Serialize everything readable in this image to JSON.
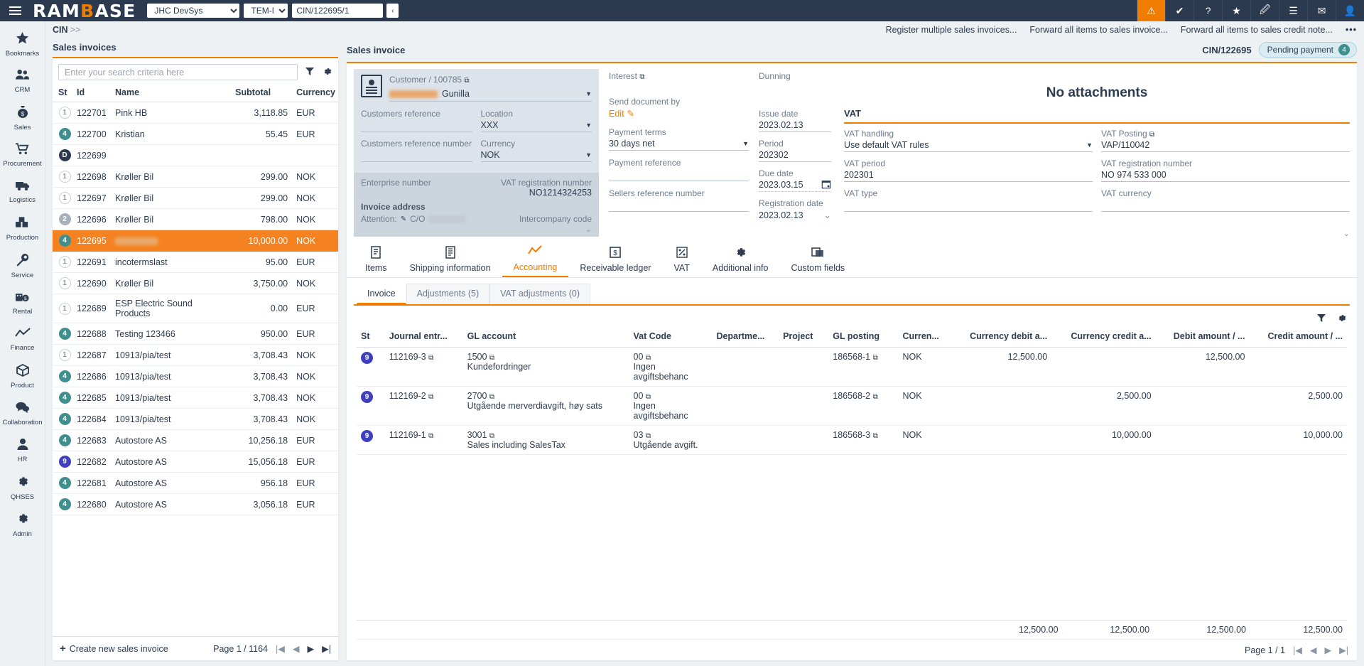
{
  "topbar": {
    "brand_left": "RAM",
    "brand_accent": "B",
    "brand_right": "ASE",
    "company": "JHC DevSys",
    "template": "TEM-NO",
    "document_ref": "CIN/122695/1",
    "collapse_icon": "‹",
    "icons": [
      {
        "name": "alert-icon",
        "glyph": "⚠",
        "active": true
      },
      {
        "name": "approval-icon",
        "glyph": "✔"
      },
      {
        "name": "help-icon",
        "glyph": "?"
      },
      {
        "name": "favorite-icon",
        "glyph": "★"
      },
      {
        "name": "attachment-icon",
        "glyph": "🖉"
      },
      {
        "name": "tasklist-icon",
        "glyph": "☰"
      },
      {
        "name": "mail-icon",
        "glyph": "✉"
      },
      {
        "name": "user-icon",
        "glyph": "👤"
      }
    ]
  },
  "sidebar": {
    "items": [
      {
        "label": "Bookmarks",
        "icon": "★"
      },
      {
        "label": "CRM",
        "icon": "👥"
      },
      {
        "label": "Sales",
        "icon": "💰"
      },
      {
        "label": "Procurement",
        "icon": "🛒"
      },
      {
        "label": "Logistics",
        "icon": "🚚"
      },
      {
        "label": "Production",
        "icon": "📦"
      },
      {
        "label": "Service",
        "icon": "🔧"
      },
      {
        "label": "Rental",
        "icon": "🏭"
      },
      {
        "label": "Finance",
        "icon": "📈"
      },
      {
        "label": "Product",
        "icon": "⬛"
      },
      {
        "label": "Collaboration",
        "icon": "💬"
      },
      {
        "label": "HR",
        "icon": "👤"
      },
      {
        "label": "QHSES",
        "icon": "⚙"
      },
      {
        "label": "Admin",
        "icon": "⚙"
      }
    ]
  },
  "breadcrumb": {
    "root": "CIN",
    "chevrons": ">>"
  },
  "actions": {
    "register_multiple": "Register multiple sales invoices...",
    "forward_invoice": "Forward all items to sales invoice...",
    "forward_credit": "Forward all items to sales credit note...",
    "more": "•••"
  },
  "list": {
    "title": "Sales invoices",
    "search_placeholder": "Enter your search criteria here",
    "filter_icon": "filter-icon",
    "settings_icon": "gear-icon",
    "columns": [
      "St",
      "Id",
      "Name",
      "Subtotal",
      "Currency"
    ],
    "rows": [
      {
        "st": "1",
        "st_style": "b-1",
        "id": "122701",
        "name": "Pink HB",
        "subtotal": "3,118.85",
        "currency": "EUR"
      },
      {
        "st": "4",
        "st_style": "b-4",
        "id": "122700",
        "name": "Kristian",
        "subtotal": "55.45",
        "currency": "EUR"
      },
      {
        "st": "D",
        "st_style": "b-D",
        "id": "122699",
        "name": "",
        "subtotal": "",
        "currency": ""
      },
      {
        "st": "1",
        "st_style": "b-1",
        "id": "122698",
        "name": "Krøller Bil",
        "subtotal": "299.00",
        "currency": "NOK"
      },
      {
        "st": "1",
        "st_style": "b-1",
        "id": "122697",
        "name": "Krøller Bil",
        "subtotal": "299.00",
        "currency": "NOK"
      },
      {
        "st": "2",
        "st_style": "b-2",
        "id": "122696",
        "name": "Krøller Bil",
        "subtotal": "798.00",
        "currency": "NOK"
      },
      {
        "st": "4",
        "st_style": "b-4",
        "id": "122695",
        "name": "",
        "redacted": true,
        "subtotal": "10,000.00",
        "currency": "NOK",
        "selected": true
      },
      {
        "st": "1",
        "st_style": "b-1",
        "id": "122691",
        "name": "incotermslast",
        "subtotal": "95.00",
        "currency": "EUR"
      },
      {
        "st": "1",
        "st_style": "b-1",
        "id": "122690",
        "name": "Krøller Bil",
        "subtotal": "3,750.00",
        "currency": "NOK"
      },
      {
        "st": "1",
        "st_style": "b-1",
        "id": "122689",
        "name": "ESP Electric Sound Products",
        "subtotal": "0.00",
        "currency": "EUR"
      },
      {
        "st": "4",
        "st_style": "b-4",
        "id": "122688",
        "name": "Testing 123466",
        "subtotal": "950.00",
        "currency": "EUR"
      },
      {
        "st": "1",
        "st_style": "b-1",
        "id": "122687",
        "name": "10913/pia/test",
        "subtotal": "3,708.43",
        "currency": "NOK"
      },
      {
        "st": "4",
        "st_style": "b-4",
        "id": "122686",
        "name": "10913/pia/test",
        "subtotal": "3,708.43",
        "currency": "NOK"
      },
      {
        "st": "4",
        "st_style": "b-4",
        "id": "122685",
        "name": "10913/pia/test",
        "subtotal": "3,708.43",
        "currency": "NOK"
      },
      {
        "st": "4",
        "st_style": "b-4",
        "id": "122684",
        "name": "10913/pia/test",
        "subtotal": "3,708.43",
        "currency": "NOK"
      },
      {
        "st": "4",
        "st_style": "b-4",
        "id": "122683",
        "name": "Autostore AS",
        "subtotal": "10,256.18",
        "currency": "EUR"
      },
      {
        "st": "9",
        "st_style": "b-9",
        "id": "122682",
        "name": "Autostore AS",
        "subtotal": "15,056.18",
        "currency": "EUR"
      },
      {
        "st": "4",
        "st_style": "b-4",
        "id": "122681",
        "name": "Autostore AS",
        "subtotal": "956.18",
        "currency": "EUR"
      },
      {
        "st": "4",
        "st_style": "b-4",
        "id": "122680",
        "name": "Autostore AS",
        "subtotal": "3,056.18",
        "currency": "EUR"
      }
    ],
    "create_label": "Create new sales invoice",
    "page_label": "Page 1 / 1164"
  },
  "detail": {
    "title": "Sales invoice",
    "doc_id": "CIN/122695",
    "status_pill": {
      "label": "Pending payment",
      "count": "4"
    },
    "customer": {
      "label": "Customer / 100785",
      "name_redacted": true,
      "name": "Gunilla",
      "customers_reference_label": "Customers reference",
      "customers_reference_value": "",
      "customers_reference_number_label": "Customers reference number",
      "customers_reference_number_value": "",
      "location_label": "Location",
      "location_value": "XXX",
      "currency_label": "Currency",
      "currency_value": "NOK",
      "enterprise_number_label": "Enterprise number",
      "enterprise_number_value": "",
      "vat_registration_number_label": "VAT registration number",
      "vat_registration_number_value": "NO1214324253",
      "invoice_address_label": "Invoice address",
      "attention_label": "Attention:",
      "attention_value": "C/O",
      "intercompany_label": "Intercompany code"
    },
    "mid": {
      "interest_label": "Interest",
      "send_document_by_label": "Send document by",
      "edit_link": "Edit",
      "payment_terms_label": "Payment terms",
      "payment_terms_value": "30 days net",
      "payment_reference_label": "Payment reference",
      "payment_reference_value": "",
      "sellers_reference_number_label": "Sellers reference number",
      "sellers_reference_number_value": ""
    },
    "dates": {
      "dunning_label": "Dunning",
      "dunning_value": "",
      "issue_date_label": "Issue date",
      "issue_date_value": "2023.02.13",
      "period_label": "Period",
      "period_value": "202302",
      "due_date_label": "Due date",
      "due_date_value": "2023.03.15",
      "registration_date_label": "Registration date",
      "registration_date_value": "2023.02.13"
    },
    "attachments": {
      "empty_text": "No attachments"
    },
    "vat": {
      "title": "VAT",
      "handling_label": "VAT handling",
      "handling_value": "Use default VAT rules",
      "posting_label": "VAT Posting",
      "posting_value": "VAP/110042",
      "period_label": "VAT period",
      "period_value": "202301",
      "registration_label": "VAT registration number",
      "registration_value": "NO 974 533 000",
      "type_label": "VAT type",
      "type_value": "",
      "currency_label": "VAT currency",
      "currency_value": ""
    },
    "tabs": [
      {
        "label": "Items",
        "icon": "📄",
        "active": false
      },
      {
        "label": "Shipping information",
        "icon": "📋",
        "active": false
      },
      {
        "label": "Accounting",
        "icon": "📈",
        "active": true
      },
      {
        "label": "Receivable ledger",
        "icon": "💲",
        "active": false
      },
      {
        "label": "VAT",
        "icon": "🧾",
        "active": false
      },
      {
        "label": "Additional info",
        "icon": "⚙",
        "active": false
      },
      {
        "label": "Custom fields",
        "icon": "🗔",
        "active": false
      }
    ],
    "subtabs": [
      {
        "label": "Invoice",
        "active": true
      },
      {
        "label": "Adjustments (5)",
        "active": false
      },
      {
        "label": "VAT adjustments (0)",
        "active": false
      }
    ]
  },
  "accounting": {
    "columns": [
      "St",
      "Journal entr...",
      "GL account",
      "Vat Code",
      "Departme...",
      "Project",
      "GL posting",
      "Curren...",
      "Currency debit a...",
      "Currency credit a...",
      "Debit amount  /  ...",
      "Credit amount  /  ..."
    ],
    "rows": [
      {
        "st": "9",
        "journal": "112169-3",
        "gl_account": "1500",
        "gl_account_desc": "Kundefordringer",
        "vat_code": "00",
        "vat_code_desc": "Ingen avgiftsbehanc",
        "department": "",
        "project": "",
        "gl_posting": "186568-1",
        "currency": "NOK",
        "currency_debit": "12,500.00",
        "currency_credit": "",
        "debit": "12,500.00",
        "credit": ""
      },
      {
        "st": "9",
        "journal": "112169-2",
        "gl_account": "2700",
        "gl_account_desc": "Utgående merverdiavgift, høy sats",
        "vat_code": "00",
        "vat_code_desc": "Ingen avgiftsbehanc",
        "department": "",
        "project": "",
        "gl_posting": "186568-2",
        "currency": "NOK",
        "currency_debit": "",
        "currency_credit": "2,500.00",
        "debit": "",
        "credit": "2,500.00"
      },
      {
        "st": "9",
        "journal": "112169-1",
        "gl_account": "3001",
        "gl_account_desc": "Sales including SalesTax",
        "vat_code": "03",
        "vat_code_desc": "Utgående avgift.",
        "department": "",
        "project": "",
        "gl_posting": "186568-3",
        "currency": "NOK",
        "currency_debit": "",
        "currency_credit": "10,000.00",
        "debit": "",
        "credit": "10,000.00"
      }
    ],
    "totals": {
      "currency_debit": "12,500.00",
      "currency_credit": "12,500.00",
      "debit": "12,500.00",
      "credit": "12,500.00"
    },
    "page_label": "Page 1 / 1"
  }
}
